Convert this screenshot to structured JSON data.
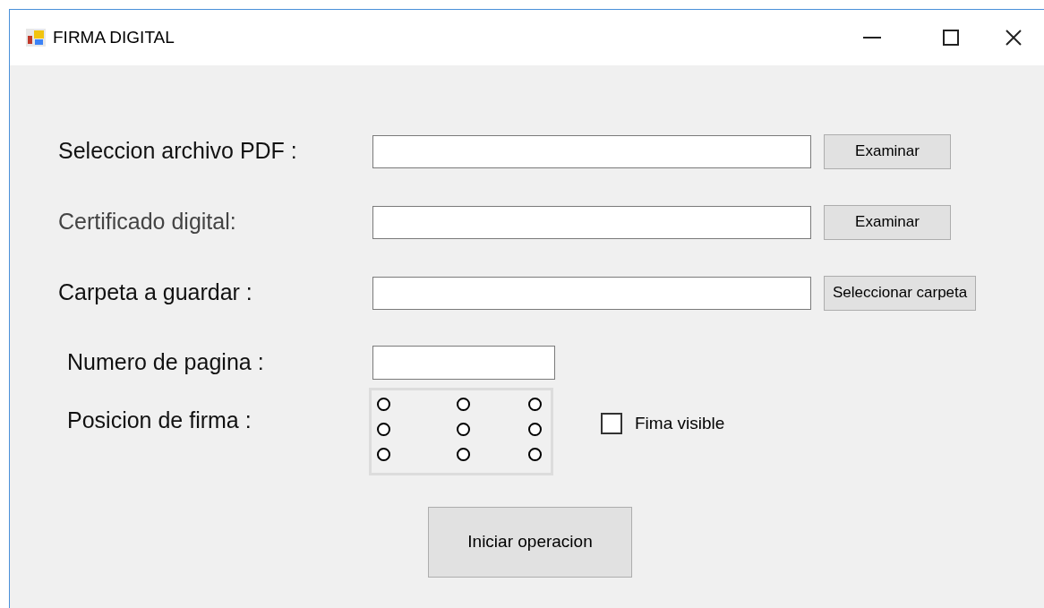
{
  "window": {
    "title": "FIRMA DIGITAL"
  },
  "file_rows": [
    {
      "label": "Seleccion archivo PDF :",
      "button": "Examinar"
    },
    {
      "label": "Certificado digital:",
      "button": "Examinar"
    },
    {
      "label": "Carpeta a guardar :",
      "button": "Seleccionar carpeta"
    }
  ],
  "page_number": {
    "label": "Numero de pagina :"
  },
  "signature_position": {
    "label": "Posicion de firma :",
    "options": [
      {
        "selected": false
      },
      {
        "selected": false
      },
      {
        "selected": false
      },
      {
        "selected": false
      },
      {
        "selected": false
      },
      {
        "selected": false
      },
      {
        "selected": false
      },
      {
        "selected": false
      },
      {
        "selected": false
      }
    ]
  },
  "visible_checkbox": {
    "label": "Fima visible",
    "checked": false
  },
  "start_button": "Iniciar operacion"
}
